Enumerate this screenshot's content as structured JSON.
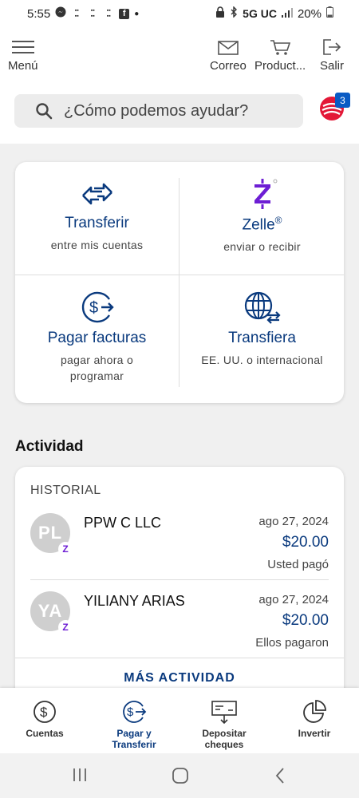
{
  "status_bar": {
    "time": "5:55",
    "network": "5G UC",
    "battery": "20%"
  },
  "header": {
    "menu_label": "Menú",
    "mail_label": "Correo",
    "products_label": "Product...",
    "logout_label": "Salir",
    "search_placeholder": "¿Cómo podemos ayudar?",
    "notification_count": "3"
  },
  "actions": {
    "transfer": {
      "title": "Transferir",
      "subtitle": "entre mis cuentas"
    },
    "zelle": {
      "title": "Zelle",
      "subtitle": "enviar o recibir"
    },
    "bills": {
      "title": "Pagar facturas",
      "subtitle_1": "pagar ahora o",
      "subtitle_2": "programar"
    },
    "wire": {
      "title": "Transfiera",
      "subtitle": "EE. UU. o internacional"
    }
  },
  "activity": {
    "title": "Actividad",
    "history_label": "HISTORIAL",
    "items": [
      {
        "initials": "PL",
        "name": "PPW C LLC",
        "date": "ago 27, 2024",
        "amount": "$20.00",
        "status": "Usted pagó"
      },
      {
        "initials": "YA",
        "name": "YILIANY ARIAS",
        "date": "ago 27, 2024",
        "amount": "$20.00",
        "status": "Ellos pagaron"
      }
    ],
    "more_label": "MÁS ACTIVIDAD"
  },
  "bottom_nav": {
    "accounts": "Cuentas",
    "pay_line1": "Pagar y",
    "pay_line2": "Transferir",
    "deposit_line1": "Depositar",
    "deposit_line2": "cheques",
    "invest": "Invertir"
  },
  "colors": {
    "brand_blue": "#0a3a7e",
    "zelle_purple": "#6d1ed4",
    "logo_red": "#e31837",
    "badge_blue": "#0a5bc4"
  }
}
